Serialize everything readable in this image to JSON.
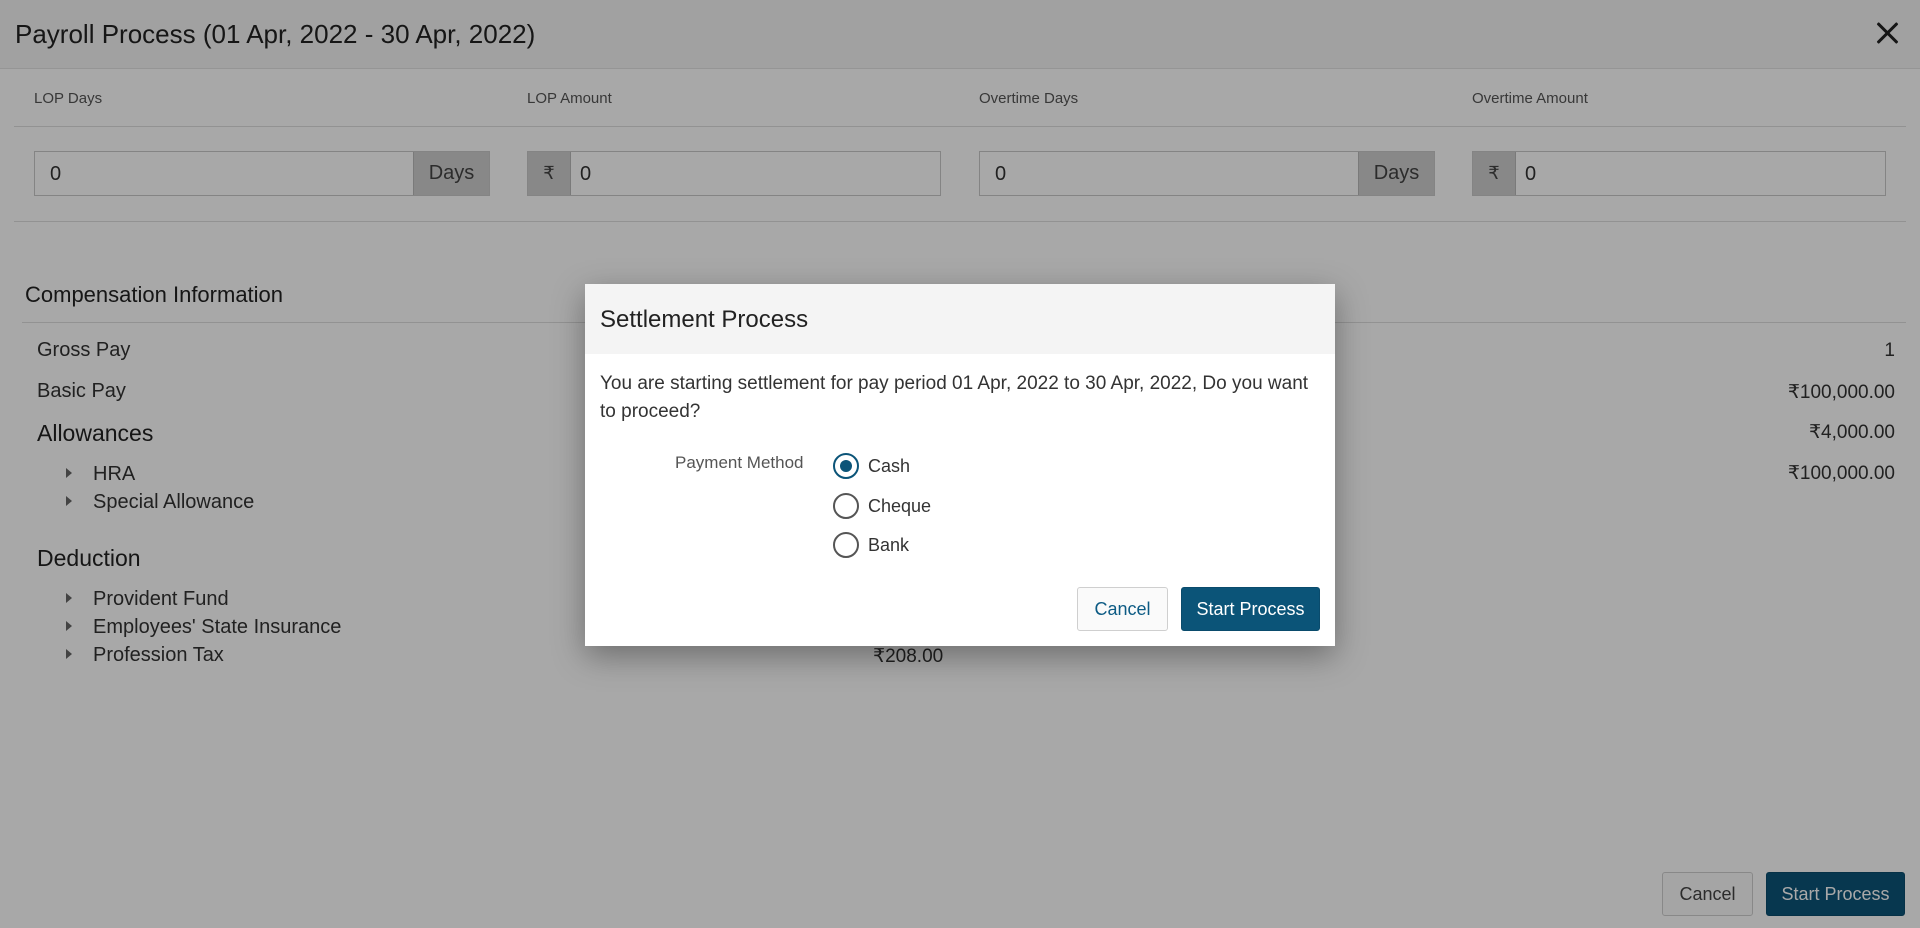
{
  "window": {
    "title": "Payroll Process (01 Apr, 2022 - 30 Apr, 2022)"
  },
  "overtime": {
    "lop_days_label": "LOP Days",
    "lop_amount_label": "LOP Amount",
    "overtime_days_label": "Overtime Days",
    "overtime_amount_label": "Overtime Amount",
    "lop_days_value": "0",
    "lop_amount_value": "0",
    "overtime_days_value": "0",
    "overtime_amount_value": "0",
    "days_unit": "Days",
    "currency_symbol": "₹"
  },
  "compensation": {
    "title": "Compensation Information",
    "gross_pay_label": "Gross Pay",
    "gross_pay_value": "1",
    "basic_pay_label": "Basic Pay",
    "basic_pay_value": "₹100,000.00",
    "allowances_label": "Allowances",
    "allowances_value": "₹4,000.00",
    "allowance_items": [
      {
        "label": "HRA",
        "value": "₹100,000.00"
      },
      {
        "label": "Special Allowance"
      }
    ],
    "deduction_label": "Deduction",
    "deduction_items": [
      {
        "label": "Provident Fund"
      },
      {
        "label": "Employees' State Insurance"
      },
      {
        "label": "Profession Tax",
        "value": "₹208.00"
      }
    ]
  },
  "footer": {
    "cancel_label": "Cancel",
    "start_label": "Start Process"
  },
  "modal": {
    "title": "Settlement Process",
    "message": "You are starting settlement for pay period 01 Apr, 2022 to 30 Apr, 2022, Do you want to proceed?",
    "payment_method_label": "Payment Method",
    "options": [
      {
        "label": "Cash",
        "selected": true
      },
      {
        "label": "Cheque",
        "selected": false
      },
      {
        "label": "Bank",
        "selected": false
      }
    ],
    "cancel_label": "Cancel",
    "start_label": "Start Process"
  },
  "colors": {
    "primary": "#0b5478",
    "link": "#0d5b84",
    "overlay": "rgba(0,0,0,0.34)"
  }
}
